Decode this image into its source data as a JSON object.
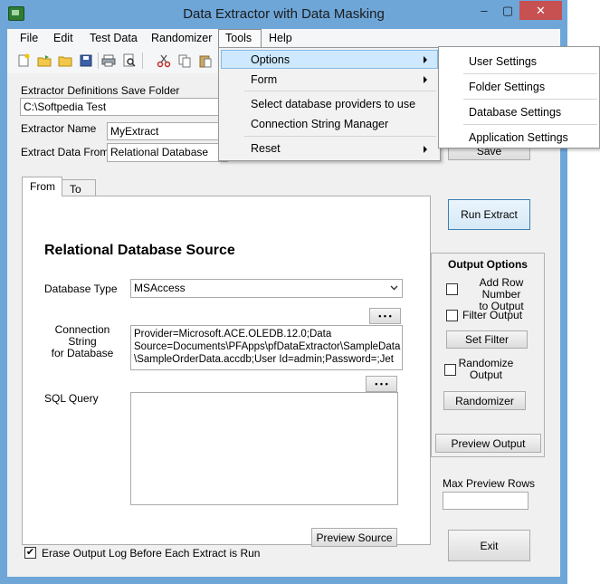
{
  "window": {
    "title": "Data Extractor with Data Masking",
    "minimize": "–",
    "maximize": "▢",
    "close": "✕"
  },
  "menu": {
    "items": [
      "File",
      "Edit",
      "Test Data",
      "Randomizer",
      "Tools",
      "Help"
    ]
  },
  "toolbar": {
    "icons": [
      "new-icon",
      "open-icon",
      "folder-icon",
      "save-icon",
      "print-icon",
      "print-preview-icon",
      "cut-icon",
      "copy-icon",
      "paste-icon"
    ]
  },
  "form": {
    "save_folder_label": "Extractor Definitions Save Folder",
    "save_folder_value": "C:\\Softpedia Test",
    "extractor_name_label": "Extractor Name",
    "extractor_name_value": "MyExtract",
    "extract_from_label": "Extract Data From",
    "extract_from_value": "Relational Database",
    "save_button": "Save"
  },
  "tabs": {
    "from": "From",
    "to": "To"
  },
  "source": {
    "heading": "Relational Database Source",
    "db_type_label": "Database Type",
    "db_type_value": "MSAccess",
    "conn_label_1": "Connection String",
    "conn_label_2": "for Database",
    "conn_line_1": "Provider=Microsoft.ACE.OLEDB.12.0;Data",
    "conn_line_2": "Source=Documents\\PFApps\\pfDataExtractor\\SampleData",
    "conn_line_3": "\\SampleOrderData.accdb;User Id=admin;Password=;Jet",
    "ellipsis": "• • •",
    "sql_label": "SQL Query",
    "sql_value": "",
    "preview_source": "Preview Source"
  },
  "actions": {
    "run_extract": "Run Extract",
    "exit": "Exit",
    "max_preview_label": "Max Preview Rows",
    "max_preview_value": ""
  },
  "output": {
    "title": "Output Options",
    "add_row_1": "Add Row Number",
    "add_row_2": "to Output",
    "filter_output": "Filter Output",
    "set_filter": "Set Filter",
    "randomize_1": "Randomize",
    "randomize_2": "Output",
    "randomizer": "Randomizer",
    "preview_output": "Preview Output"
  },
  "erase_log": {
    "label": "Erase Output Log Before Each Extract is Run",
    "checked": "✔"
  },
  "tools_menu": {
    "options": "Options",
    "form": "Form",
    "select_providers": "Select database providers to use",
    "connection_manager": "Connection String Manager",
    "reset": "Reset"
  },
  "options_submenu": {
    "user_settings": "User Settings",
    "folder_settings": "Folder Settings",
    "database_settings": "Database Settings",
    "application_settings": "Application Settings"
  },
  "colors": {
    "frame": "#6ea6d8",
    "highlight": "#cde8ff",
    "highlight_border": "#84b9e6",
    "close": "#c75050"
  }
}
